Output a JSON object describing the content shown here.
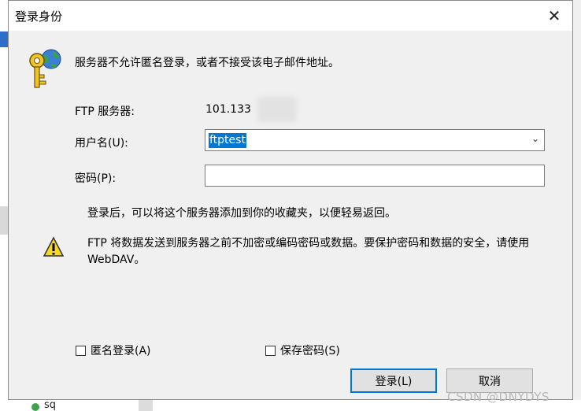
{
  "dialog": {
    "title": "登录身份",
    "close_glyph": "✕",
    "message": "服务器不允许匿名登录，或者不接受该电子邮件地址。",
    "server_label": "FTP 服务器:",
    "server_value": "101.133",
    "username_label": "用户名(U):",
    "username_value": "ftptest",
    "password_label": "密码(P):",
    "password_value": "",
    "hint": "登录后，可以将这个服务器添加到你的收藏夹，以便轻易返回。",
    "warning": "FTP 将数据发送到服务器之前不加密或编码密码或数据。要保护密码和数据的安全，请使用 WebDAV。",
    "anonymous_label": "匿名登录(A)",
    "save_password_label": "保存密码(S)",
    "login_button": "登录(L)",
    "cancel_button": "取消"
  },
  "background": {
    "bottom_text": "sq"
  },
  "watermark": "CSDN @DNYDYS",
  "colors": {
    "selection": "#0078d7",
    "dialog_bg": "#f0f0f0",
    "titlebar_bg": "#ffffff"
  },
  "icons": {
    "key": "key-globe-icon",
    "warning": "warning-icon",
    "dropdown": "chevron-down-icon",
    "close": "close-icon"
  }
}
